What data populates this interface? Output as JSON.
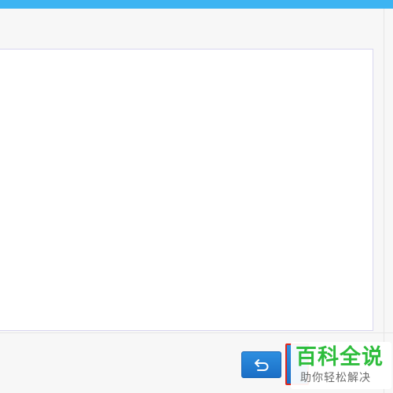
{
  "toolbar": {
    "undo_icon": "undo-arrow-icon"
  },
  "watermark": {
    "title": "百科全说",
    "subtitle": "助你轻松解决"
  },
  "colors": {
    "top_bar": "#3db4f2",
    "button_blue": "#1b6fc6",
    "highlight_red": "#e0261b",
    "watermark_green": "#2ebd3c"
  }
}
